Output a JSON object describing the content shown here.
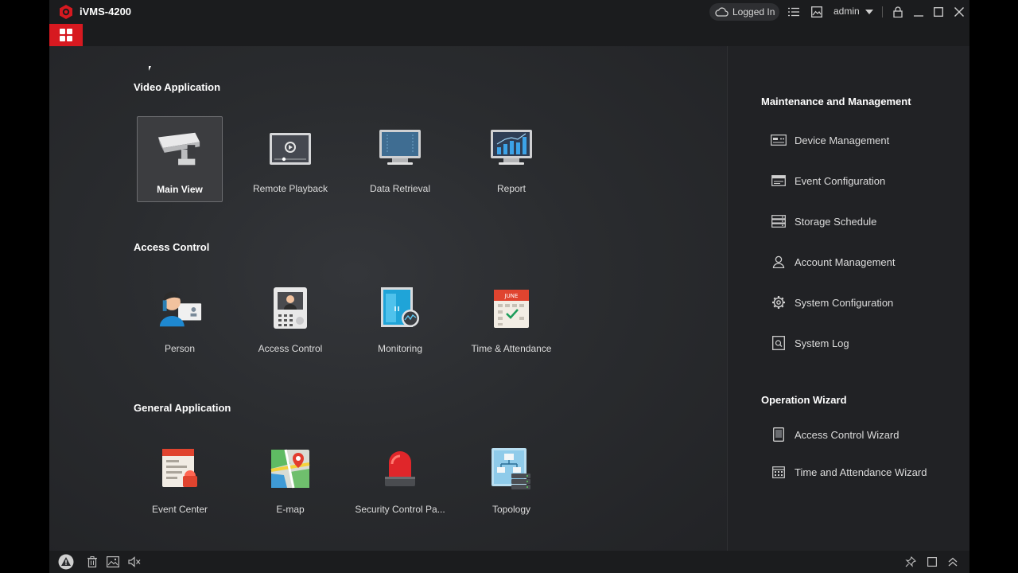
{
  "titlebar": {
    "app_title": "iVMS-4200",
    "status": "Logged In",
    "user": "admin"
  },
  "sections": {
    "video": {
      "title": "Video Application",
      "items": [
        {
          "label": "Main View",
          "icon": "camera-icon"
        },
        {
          "label": "Remote Playback",
          "icon": "playback-icon"
        },
        {
          "label": "Data Retrieval",
          "icon": "monitor-icon"
        },
        {
          "label": "Report",
          "icon": "report-chart-icon"
        }
      ]
    },
    "access": {
      "title": "Access Control",
      "items": [
        {
          "label": "Person",
          "icon": "person-icon"
        },
        {
          "label": "Access Control",
          "icon": "door-station-icon"
        },
        {
          "label": "Monitoring",
          "icon": "door-monitor-icon"
        },
        {
          "label": "Time & Attendance",
          "icon": "calendar-icon"
        }
      ]
    },
    "general": {
      "title": "General Application",
      "items": [
        {
          "label": "Event Center",
          "icon": "event-center-icon"
        },
        {
          "label": "E-map",
          "icon": "map-icon"
        },
        {
          "label": "Security Control Pa...",
          "icon": "alarm-light-icon"
        },
        {
          "label": "Topology",
          "icon": "topology-icon"
        }
      ]
    }
  },
  "right_panel": {
    "maintenance_title": "Maintenance and Management",
    "maintenance_items": [
      {
        "label": "Device Management",
        "icon": "device-icon"
      },
      {
        "label": "Event Configuration",
        "icon": "event-config-icon"
      },
      {
        "label": "Storage Schedule",
        "icon": "storage-icon"
      },
      {
        "label": "Account Management",
        "icon": "account-icon"
      },
      {
        "label": "System Configuration",
        "icon": "gear-icon"
      },
      {
        "label": "System Log",
        "icon": "log-icon"
      }
    ],
    "wizard_title": "Operation Wizard",
    "wizard_items": [
      {
        "label": "Access Control Wizard",
        "icon": "tablet-icon"
      },
      {
        "label": "Time and Attendance Wizard",
        "icon": "calendar-grid-icon"
      }
    ]
  },
  "colors": {
    "accent": "#d71920",
    "background": "#1c1d1f",
    "selected_tile": "#3c3d40"
  }
}
